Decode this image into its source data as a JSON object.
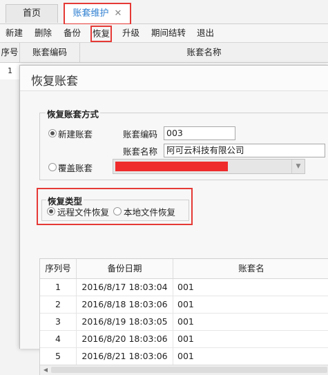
{
  "tabs": [
    {
      "label": "首页"
    },
    {
      "label": "账套维护",
      "close": "✕"
    }
  ],
  "toolbar": {
    "items": [
      "新建",
      "删除",
      "备份",
      "恢复",
      "升级",
      "期间结转",
      "退出"
    ]
  },
  "grid": {
    "headers": [
      "序号",
      "账套编码",
      "账套名称"
    ],
    "first_row_index": "1"
  },
  "dialog": {
    "title": "恢复账套",
    "mode_group": {
      "legend": "恢复账套方式",
      "new_label": "新建账套",
      "code_label": "账套编码",
      "code_value": "003",
      "name_label": "账套名称",
      "name_value": "阿可云科技有限公司",
      "overwrite_label": "覆盖账套"
    },
    "type_group": {
      "legend": "恢复类型",
      "remote_label": "远程文件恢复",
      "local_label": "本地文件恢复"
    },
    "table": {
      "headers": [
        "序列号",
        "备份日期",
        "账套名"
      ],
      "rows": [
        {
          "no": "1",
          "date": "2016/8/17 18:03:04",
          "name": "001"
        },
        {
          "no": "2",
          "date": "2016/8/18 18:03:06",
          "name": "001"
        },
        {
          "no": "3",
          "date": "2016/8/19 18:03:05",
          "name": "001"
        },
        {
          "no": "4",
          "date": "2016/8/20 18:03:06",
          "name": "001"
        },
        {
          "no": "5",
          "date": "2016/8/21 18:03:06",
          "name": "001"
        }
      ]
    }
  }
}
